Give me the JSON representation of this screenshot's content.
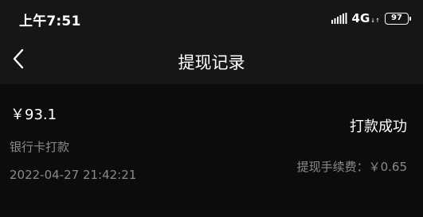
{
  "status_bar": {
    "time": "上午7:51",
    "network": "4G",
    "network_arrows": "↓↑",
    "battery": "97"
  },
  "nav": {
    "title": "提现记录"
  },
  "record": {
    "amount": "￥93.1",
    "method": "银行卡打款",
    "datetime": "2022-04-27 21:42:21",
    "status": "打款成功",
    "fee_label": "提现手续费：",
    "fee_value": "￥0.65"
  }
}
